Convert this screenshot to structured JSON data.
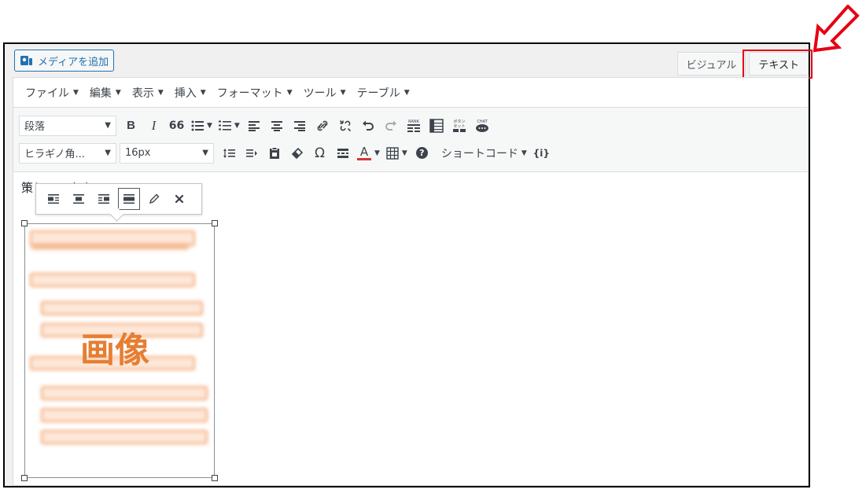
{
  "header": {
    "media_button_label": "メディアを追加",
    "tabs": [
      {
        "label": "ビジュアル"
      },
      {
        "label": "テキスト"
      }
    ]
  },
  "menubar": {
    "items": [
      {
        "label": "ファイル"
      },
      {
        "label": "編集"
      },
      {
        "label": "表示"
      },
      {
        "label": "挿入"
      },
      {
        "label": "フォーマット"
      },
      {
        "label": "ツール"
      },
      {
        "label": "テーブル"
      }
    ]
  },
  "toolbar": {
    "block_format": "段落",
    "font_family": "ヒラギノ角...",
    "font_size": "16px",
    "shortcode_label": "ショートコード"
  },
  "icon_text": {
    "bold": "B",
    "italic": "I",
    "blockquote": "66",
    "omega": "Ω",
    "font_color": "A",
    "help": "?",
    "shortcode_braces": "{i}",
    "rank": "RANK",
    "button_set_top": "ボタン",
    "button_set_bottom": "セット",
    "chat": "CHAT"
  },
  "content": {
    "paragraph_text": "策しています",
    "image_label": "画像"
  },
  "colors": {
    "annotation_red": "#e60012",
    "accent_blue": "#2271b1",
    "image_label_orange": "#e67e32"
  }
}
